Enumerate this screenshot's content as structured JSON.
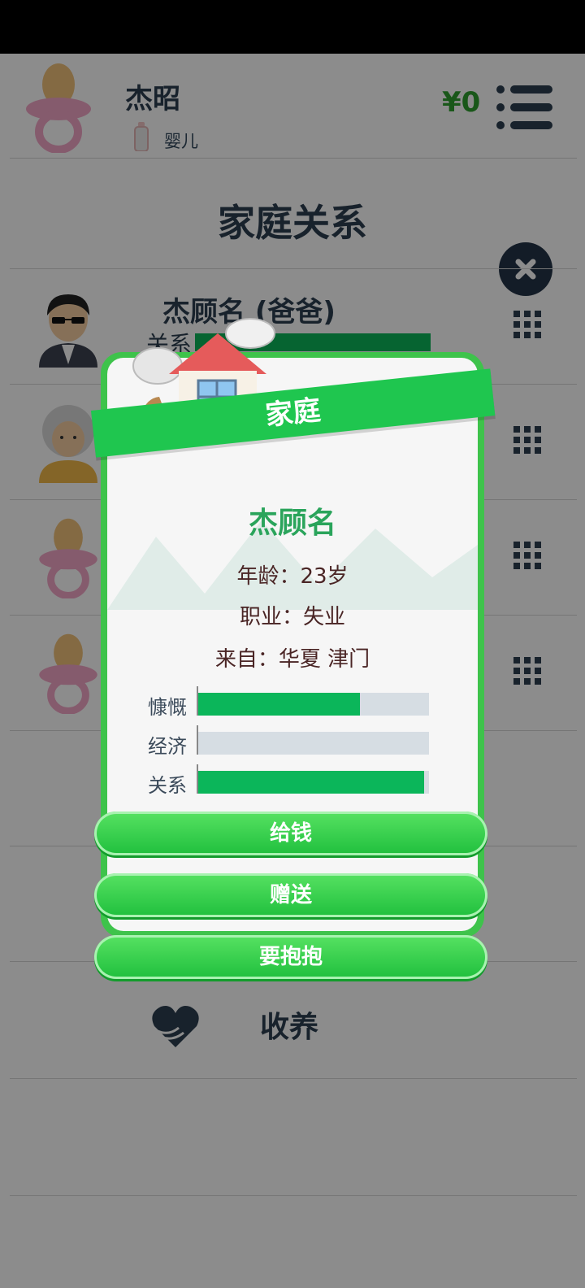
{
  "header": {
    "player_name": "杰昭",
    "stage": "婴儿",
    "money": "¥0"
  },
  "section": {
    "title": "家庭关系"
  },
  "family_rows": [
    {
      "label": "杰顾名 (爸爸)",
      "partial_text": "关系"
    }
  ],
  "adopt_label": "收养",
  "dialog": {
    "ribbon_title": "家庭",
    "person_name": "杰顾名",
    "age_line": "年龄：23岁",
    "job_line": "职业：失业",
    "origin_line": "来自：华夏 津门",
    "stats": [
      {
        "label": "慷慨",
        "value": 0.7
      },
      {
        "label": "经济",
        "value": 0.0
      },
      {
        "label": "关系",
        "value": 0.98
      }
    ],
    "actions": [
      "给钱",
      "赠送",
      "要抱抱"
    ]
  },
  "colors": {
    "accent_green": "#1fc64f",
    "bar_fill": "#0bb65a",
    "money": "#2e9e2e"
  }
}
